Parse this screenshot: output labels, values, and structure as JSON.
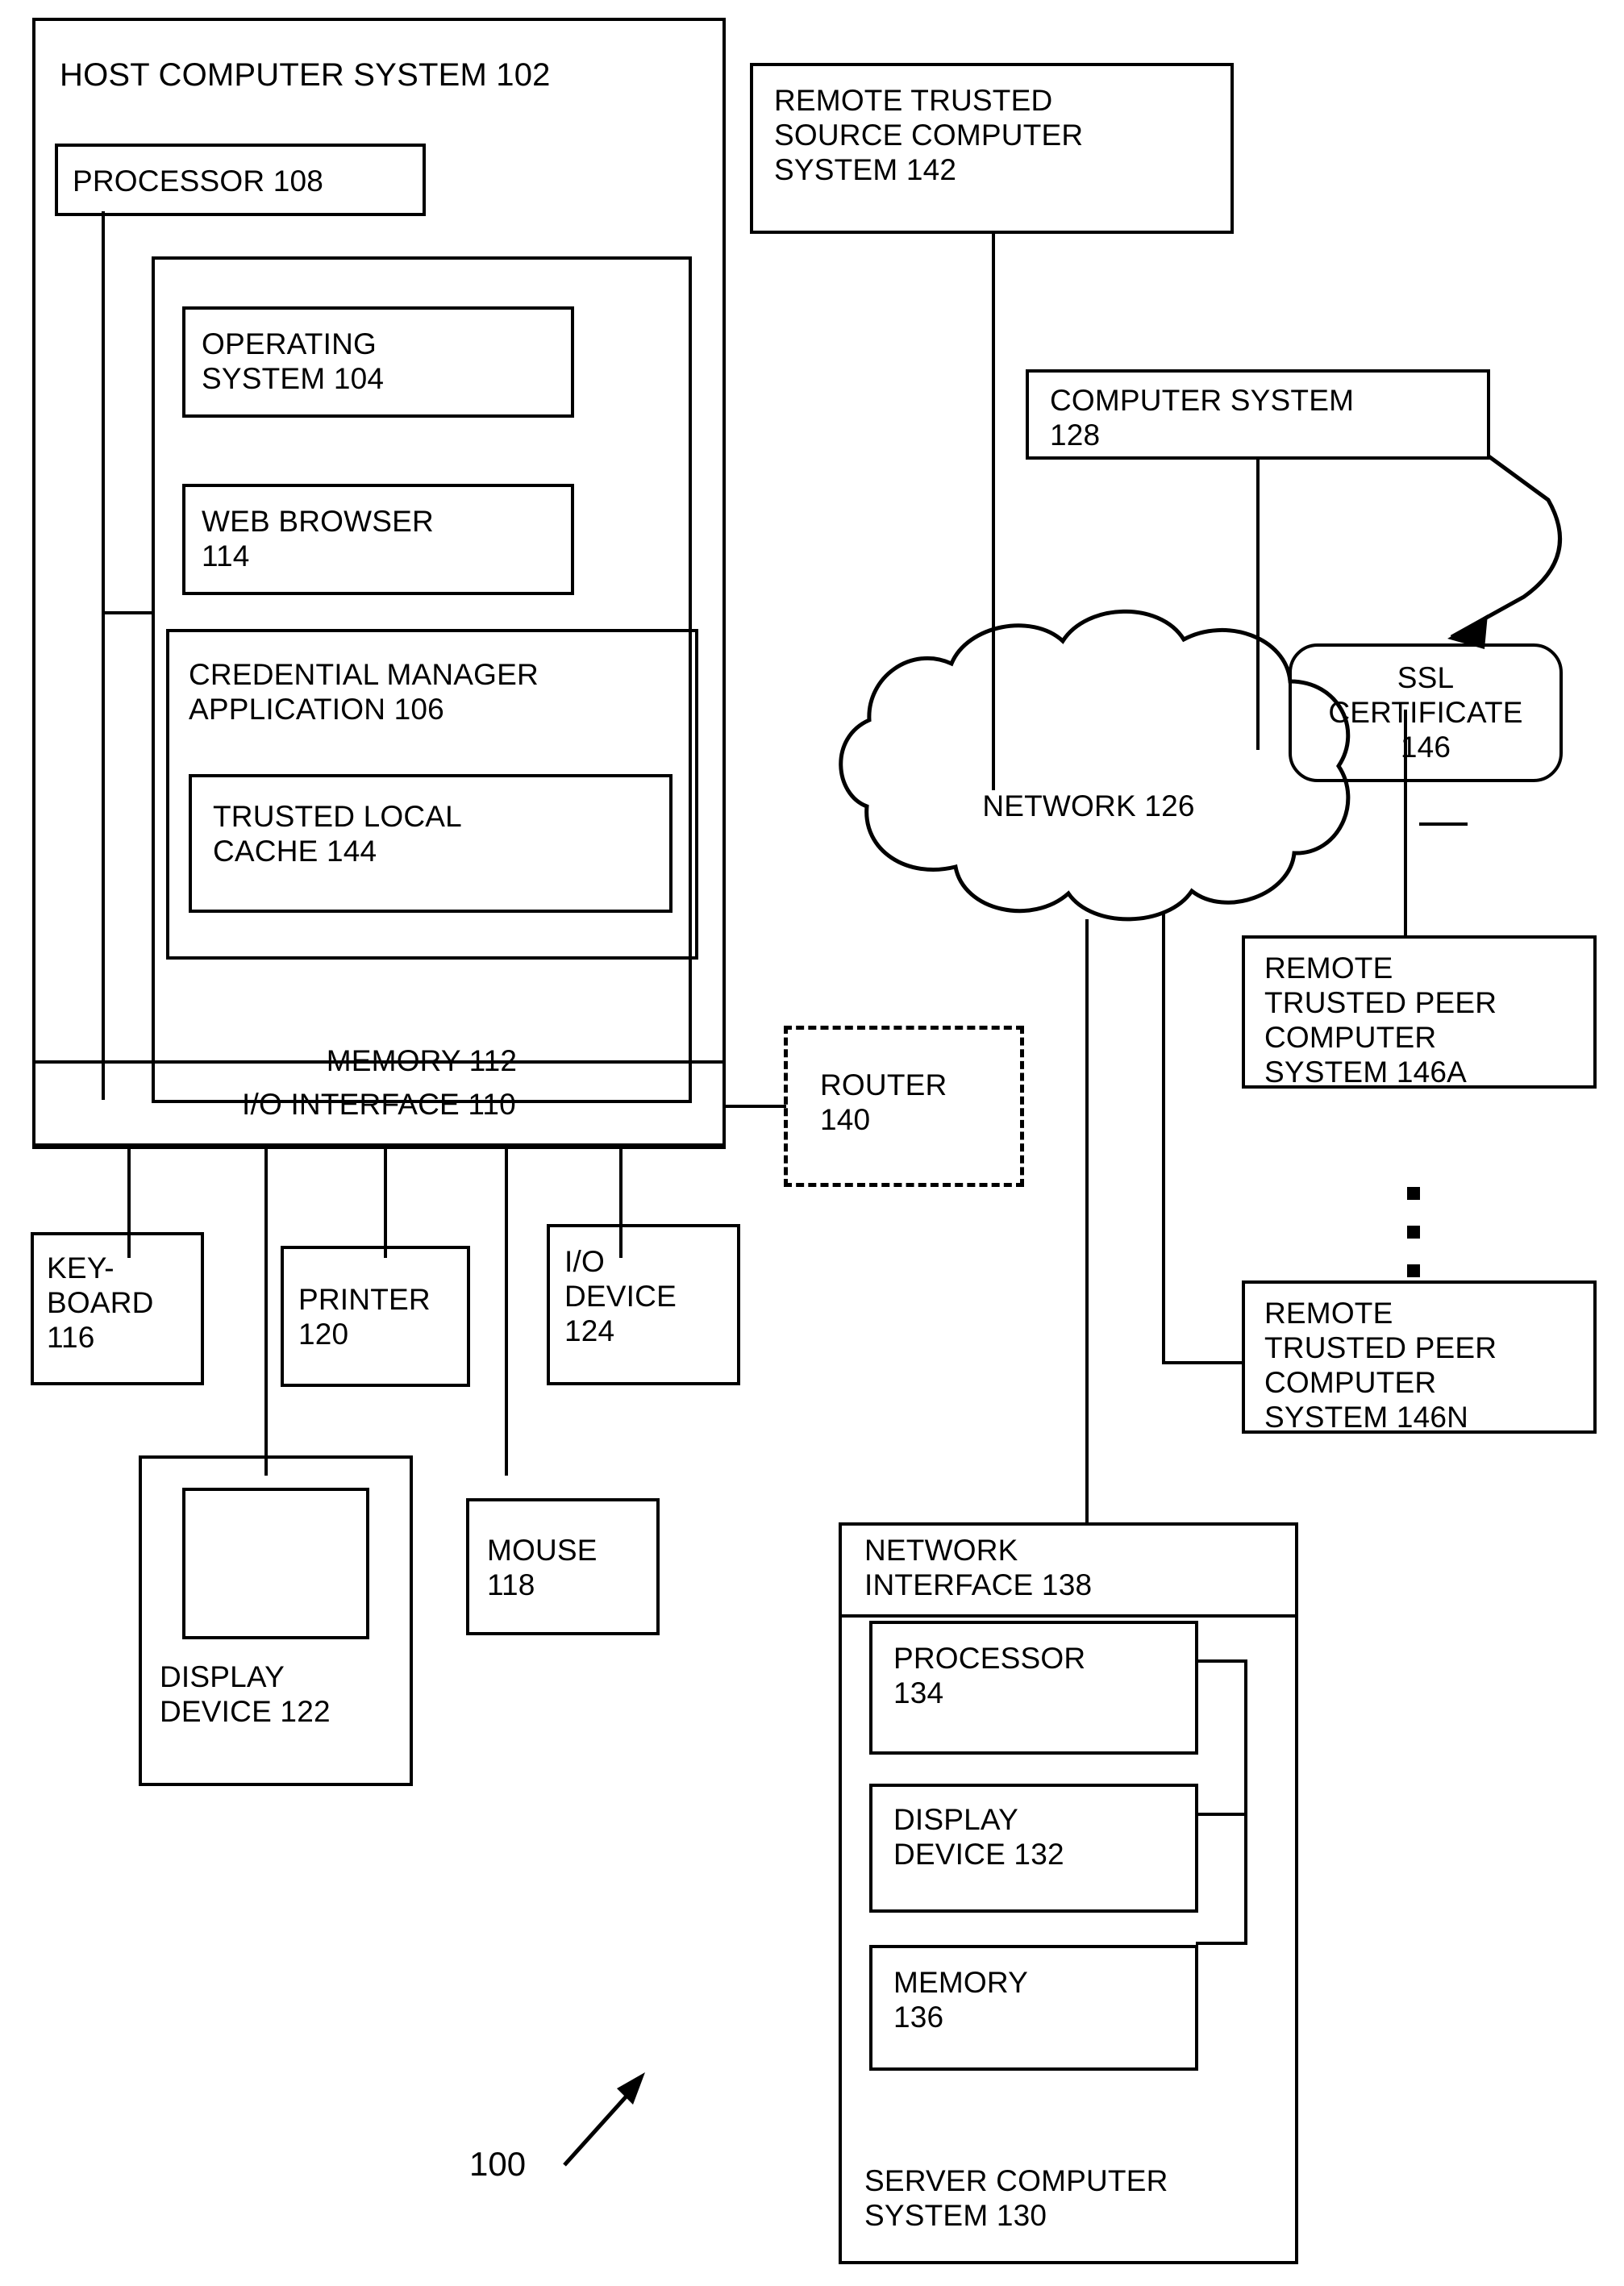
{
  "figure": {
    "reference_label": "100",
    "line_color": "#000000",
    "background": "#ffffff"
  },
  "host": {
    "title": "HOST COMPUTER SYSTEM 102",
    "processor": "PROCESSOR  108",
    "memory_label": "MEMORY 112",
    "operating_system": "OPERATING\nSYSTEM  104",
    "web_browser": "WEB BROWSER\n114",
    "credential_manager": "CREDENTIAL MANAGER\nAPPLICATION   106",
    "trusted_local_cache": "TRUSTED LOCAL\n CACHE  144",
    "io_interface": "I/O INTERFACE 110"
  },
  "peripherals": {
    "keyboard": "KEY-\nBOARD\n 116",
    "printer": "PRINTER\n   120",
    "io_device": "I/O\nDEVICE\n   124",
    "display_device": "DISPLAY\nDEVICE  122",
    "mouse": "MOUSE\n  118"
  },
  "network_side": {
    "remote_trusted_source": "REMOTE TRUSTED\nSOURCE COMPUTER\nSYSTEM   142",
    "computer_system": "COMPUTER SYSTEM\n128",
    "ssl_certificate": "SSL\nCERTIFICATE\n146",
    "network_cloud": "NETWORK 126",
    "router": "ROUTER\n   140",
    "remote_peer_a": "REMOTE\nTRUSTED PEER\nCOMPUTER\nSYSTEM 146A",
    "remote_peer_n": "REMOTE\nTRUSTED PEER\nCOMPUTER\nSYSTEM 146N",
    "vertical_ellipsis": "⦁"
  },
  "server": {
    "network_interface": "NETWORK\nINTERFACE 138",
    "processor": "PROCESSOR\n      134",
    "display_device": "DISPLAY\nDEVICE 132",
    "memory": "MEMORY\n    136",
    "title": "SERVER COMPUTER\nSYSTEM              130"
  }
}
